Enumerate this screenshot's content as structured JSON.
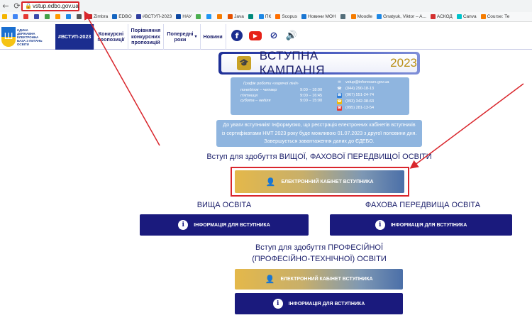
{
  "browser": {
    "url": "vstup.edbo.gov.ua",
    "bookmarks": [
      {
        "label": "",
        "color": "#f4b400"
      },
      {
        "label": "",
        "color": "#4285f4"
      },
      {
        "label": "",
        "color": "#e53935"
      },
      {
        "label": "",
        "color": "#3949ab"
      },
      {
        "label": "",
        "color": "#43a047"
      },
      {
        "label": "",
        "color": "#ff9800"
      },
      {
        "label": "",
        "color": "#1e88e5"
      },
      {
        "label": "",
        "color": "#555555"
      },
      {
        "label": "Zimbra",
        "color": "#c62828"
      },
      {
        "label": "EDBO",
        "color": "#1565c0"
      },
      {
        "label": "#ВСТУП-2023",
        "color": "#303f9f"
      },
      {
        "label": "НАУ",
        "color": "#0d47a1"
      },
      {
        "label": "",
        "color": "#4caf50"
      },
      {
        "label": "",
        "color": "#2196f3"
      },
      {
        "label": "",
        "color": "#f57c00"
      },
      {
        "label": "Java",
        "color": "#e65100"
      },
      {
        "label": "",
        "color": "#00897b"
      },
      {
        "label": "ПК",
        "color": "#1e88e5"
      },
      {
        "label": "Scopus",
        "color": "#ff6f00"
      },
      {
        "label": "Новини МОН",
        "color": "#1976d2"
      },
      {
        "label": "",
        "color": "#546e7a"
      },
      {
        "label": "Moodle",
        "color": "#f57c00"
      },
      {
        "label": "Gnatyuk, Viktor – A...",
        "color": "#1e88e5"
      },
      {
        "label": "АСКОД",
        "color": "#d32f2f"
      },
      {
        "label": "Canva",
        "color": "#00c4cc"
      },
      {
        "label": "Course: Те",
        "color": "#f57c00"
      }
    ]
  },
  "header": {
    "logo_text": "Єдина\nдержавна\nелектронна\nбаза з питань\nосвіти",
    "nav": [
      {
        "label": "#ВСТУП-2023",
        "active": true
      },
      {
        "label": "Конкурсні\nпропозиції",
        "active": false
      },
      {
        "label": "Порівняння\nконкурсних\nпропозицій",
        "active": false
      },
      {
        "label": "Попередні\nроки",
        "active": false,
        "dropdown": true
      },
      {
        "label": "Новини",
        "active": false
      }
    ]
  },
  "banner": {
    "title": "ВСТУПНА КАМПАНІЯ",
    "year": "2023"
  },
  "schedule": {
    "heading": "Графік роботи «гарячої лінії»",
    "rows": [
      {
        "days": "понеділок – четвер",
        "hours": "9:00 – 18:00"
      },
      {
        "days": "п'ятниця",
        "hours": "9:00 – 16:45"
      },
      {
        "days": "субота – неділя",
        "hours": "9:00 – 15:00"
      }
    ]
  },
  "contacts": [
    {
      "text": "vstup@inforesurs.gov.ua",
      "color": "#ffffff"
    },
    {
      "text": "(044) 290-18-13",
      "color": "#ffffff"
    },
    {
      "text": "(067) 551-24-74",
      "color": "#2e7dd7"
    },
    {
      "text": "(093) 342-38-63",
      "color": "#f2b705"
    },
    {
      "text": "(095) 281-13-54",
      "color": "#e53935"
    }
  ],
  "notice": "До уваги вступників! Інформуємо, що реєстрація електронних кабінетів вступників із сертифікатами НМТ 2023 року буде можливою 01.07.2023 з другої половини дня. Завершується завантаження даних до ЄДЕБО.",
  "sections": {
    "higher_title": "Вступ для здобуття ВИЩОЇ, ФАХОВОЇ ПЕРЕДВИЩОЇ ОСВІТИ",
    "cabinet_label": "ЕЛЕКТРОННИЙ КАБІНЕТ ВСТУПНИКА",
    "vo_title": "ВИЩА ОСВІТА",
    "fpo_title": "ФАХОВА ПЕРЕДВИЩА ОСВІТА",
    "info_label": "ІНФОРМАЦІЯ ДЛЯ ВСТУПНИКА",
    "prof_title": "Вступ для здобуття ПРОФЕСІЙНОЇ\n(ПРОФЕСІЙНО-ТЕХНІЧНОЇ) ОСВІТИ"
  },
  "colors": {
    "navy": "#1a1a7d",
    "annotation_red": "#d9262c",
    "info_blue": "#8fb5df"
  }
}
